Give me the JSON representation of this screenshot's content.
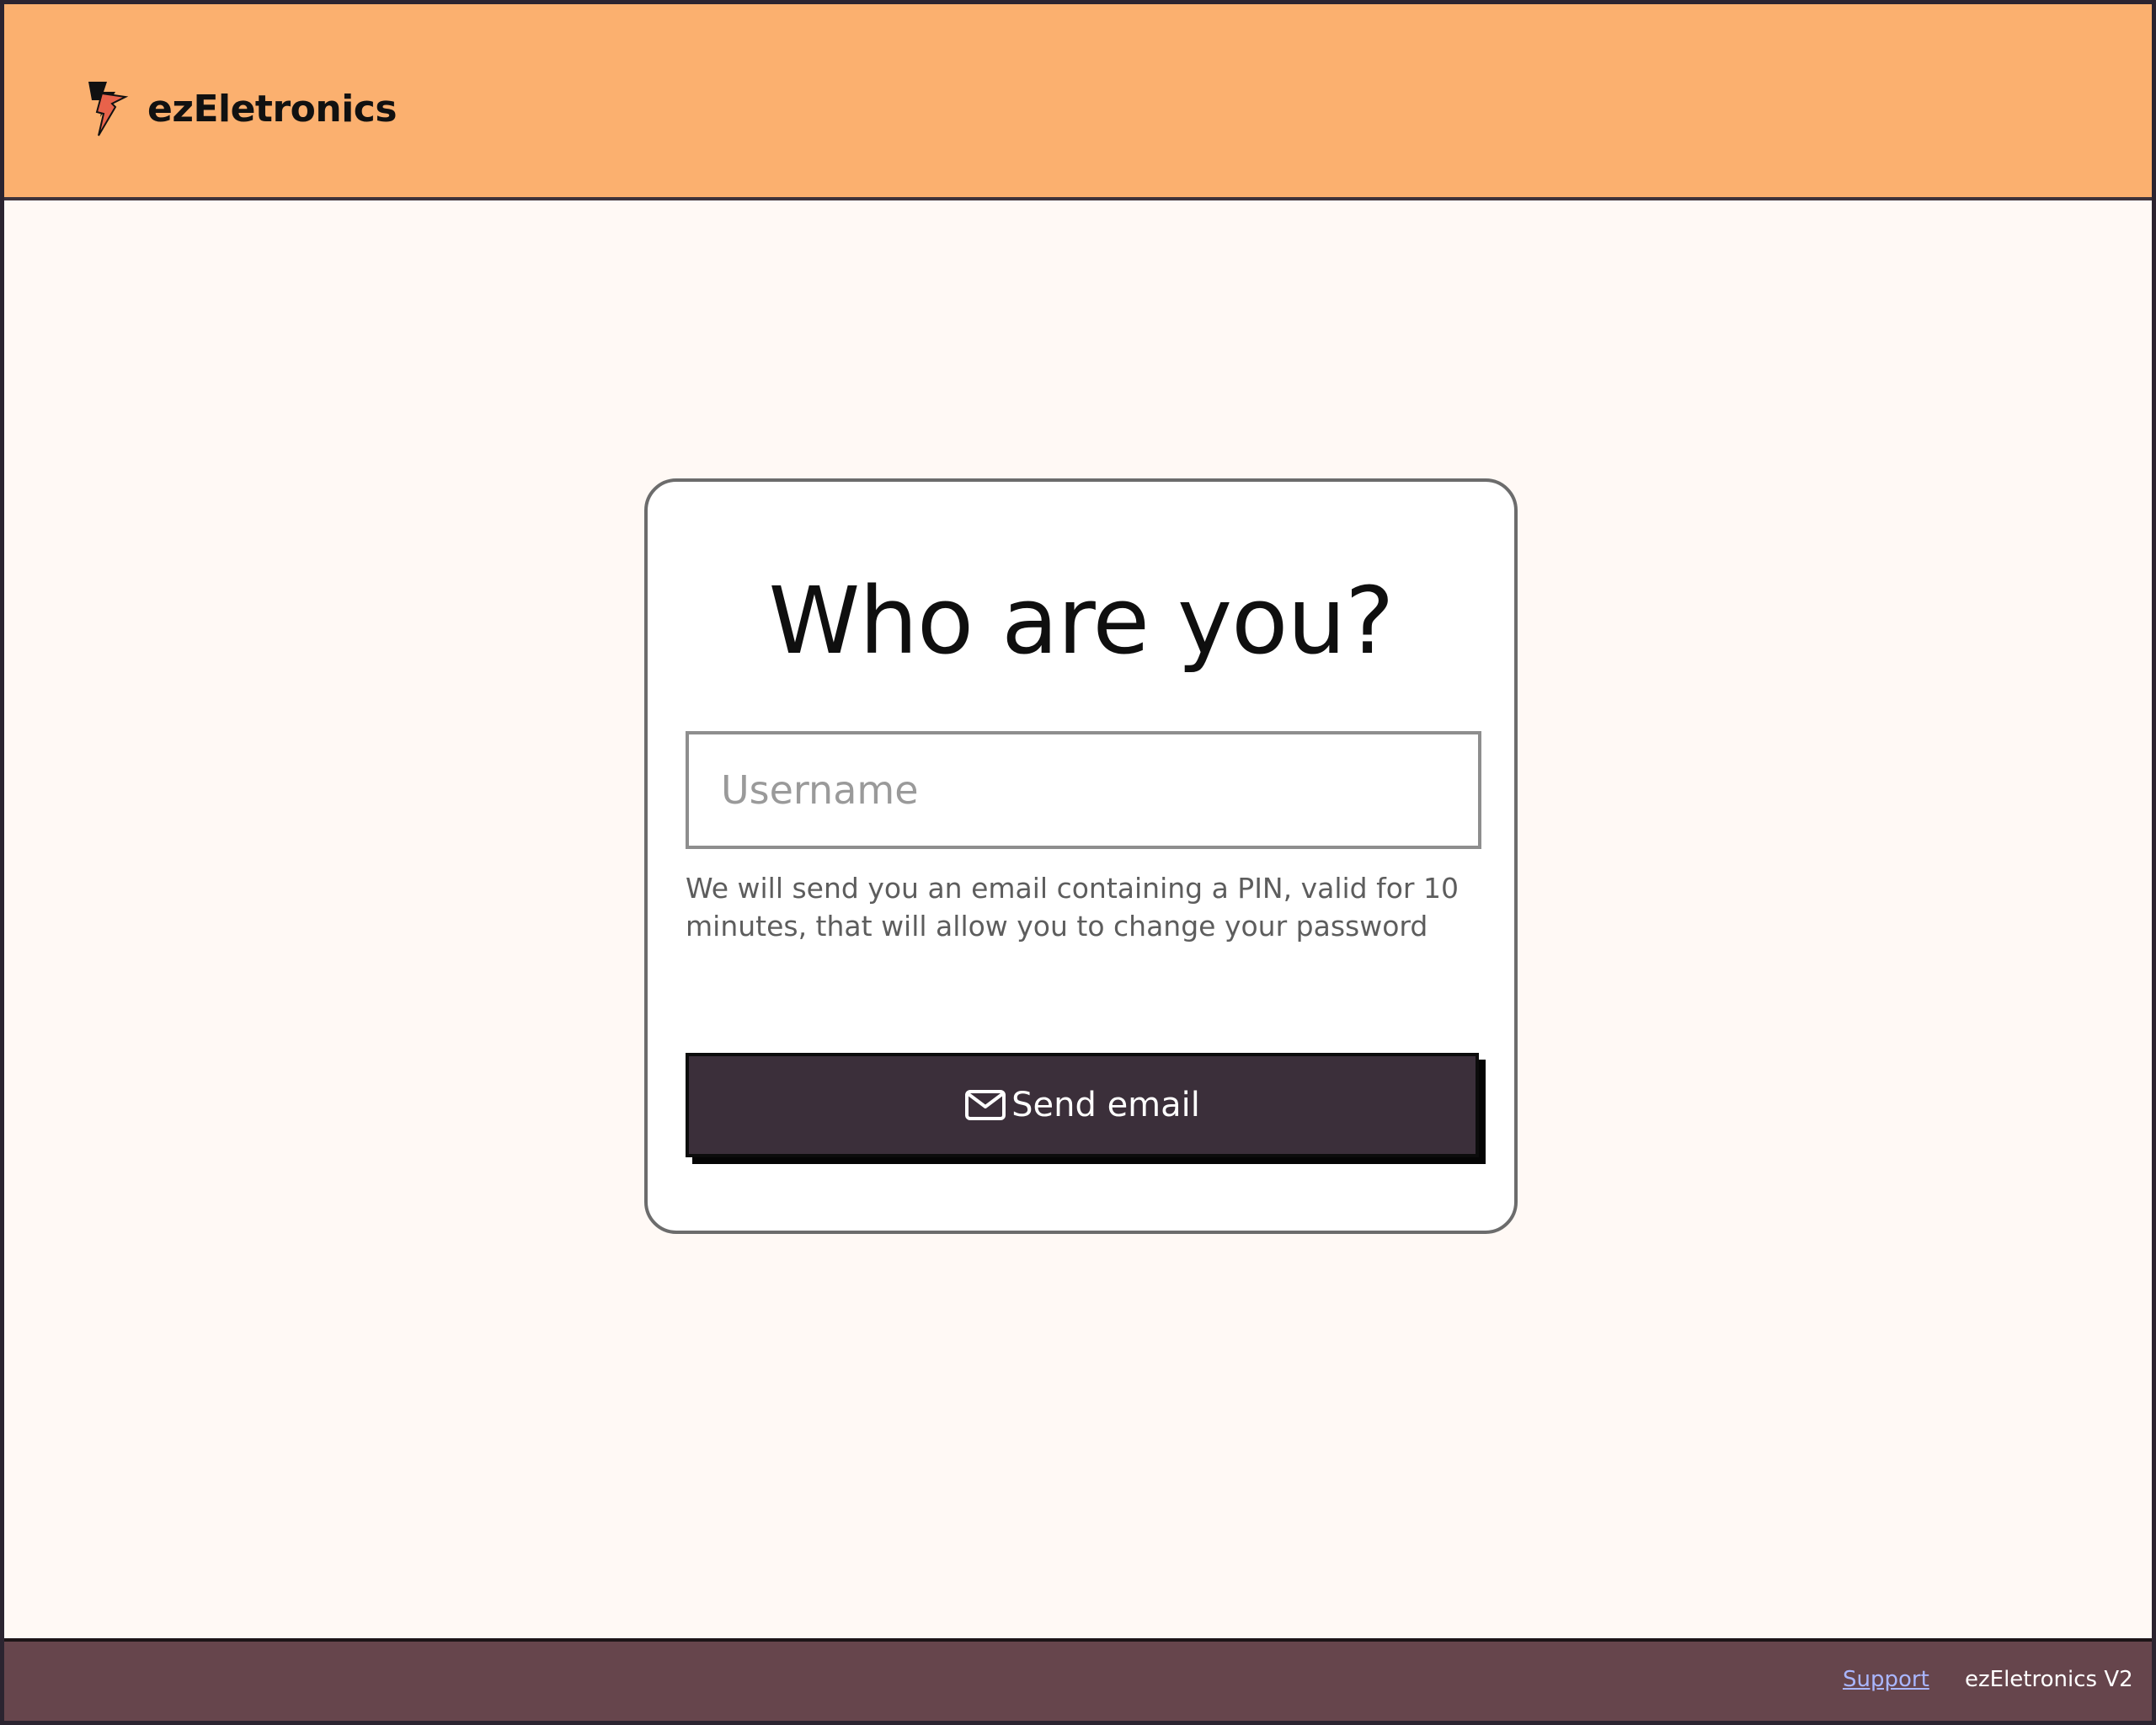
{
  "header": {
    "brand_name": "ezEletronics",
    "logo_icon": "lightning-bolt-icon",
    "background_color": "#fbb06f"
  },
  "card": {
    "title": "Who are you?",
    "username_input": {
      "placeholder": "Username",
      "value": ""
    },
    "helper_text": "We will send you an email containing a PIN,  valid for 10 minutes, that will allow you to change your password",
    "send_button": {
      "label": "Send email",
      "icon": "mail-icon",
      "background_color": "#3b2f3a"
    }
  },
  "footer": {
    "support_link": "Support",
    "version": "ezEletronics V2",
    "background_color": "#66454c"
  }
}
